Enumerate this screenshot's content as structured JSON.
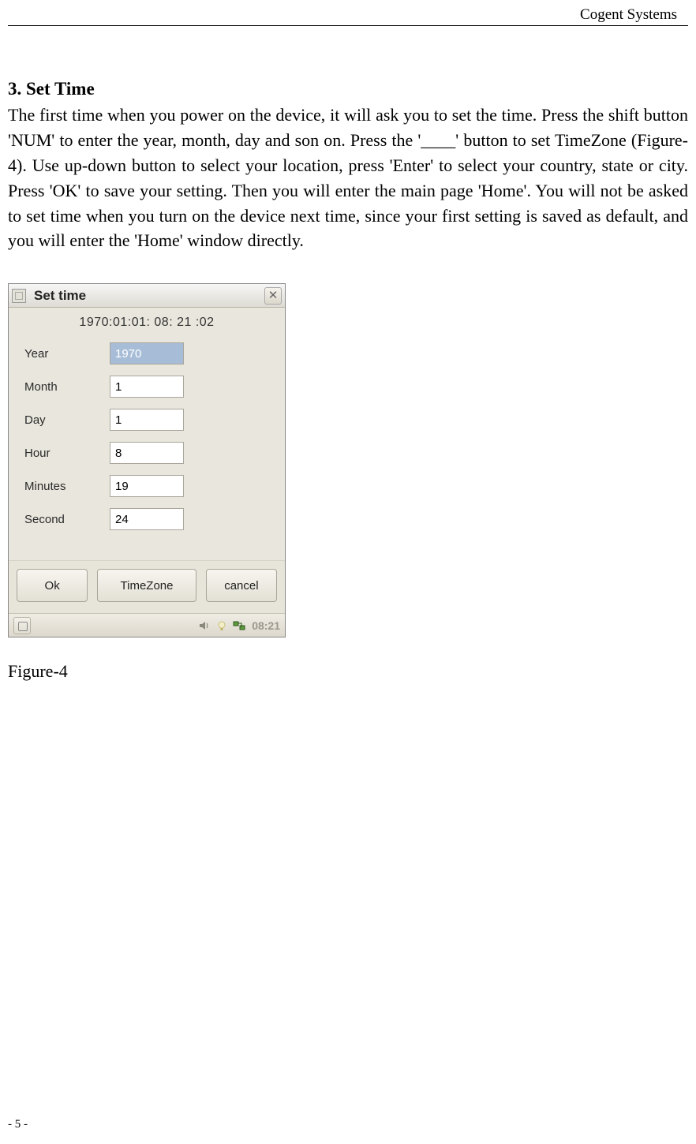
{
  "header": {
    "company": "Cogent Systems"
  },
  "section": {
    "heading": "3. Set Time",
    "paragraph": "The first time when you power on the device, it will ask you to set the time. Press the shift button 'NUM' to enter the year, month, day and son on. Press the '____' button to set TimeZone (Figure-4). Use up-down button to select your location, press 'Enter' to select your country, state or city. Press 'OK' to save your setting. Then you will enter the main page 'Home'. You will not be asked to set time when you turn on the device next time, since your first setting is saved as default, and you will enter the 'Home' window directly."
  },
  "dialog": {
    "title": "Set time",
    "datetime": "1970:01:01:  08: 21 :02",
    "fields": {
      "year": {
        "label": "Year",
        "value": "1970"
      },
      "month": {
        "label": "Month",
        "value": "1"
      },
      "day": {
        "label": "Day",
        "value": "1"
      },
      "hour": {
        "label": "Hour",
        "value": "8"
      },
      "minutes": {
        "label": "Minutes",
        "value": "19"
      },
      "second": {
        "label": "Second",
        "value": "24"
      }
    },
    "buttons": {
      "ok": "Ok",
      "timezone": "TimeZone",
      "cancel": "cancel"
    },
    "taskbar_clock": "08:21"
  },
  "figure_caption": "Figure-4",
  "footer": {
    "page_number": "- 5 -"
  }
}
